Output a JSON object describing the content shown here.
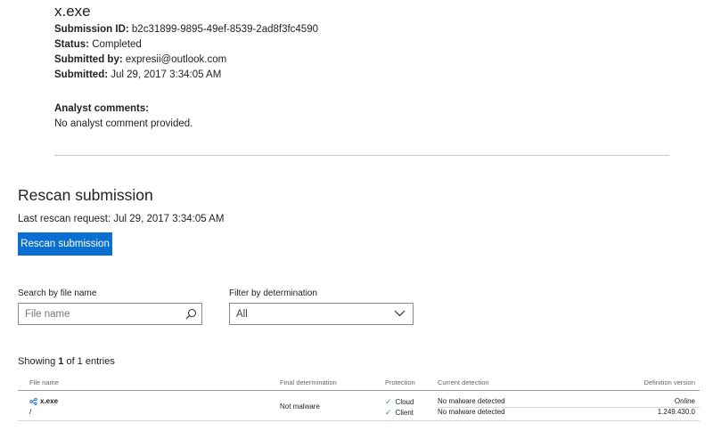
{
  "submission": {
    "file_name": "x.exe",
    "id_label": "Submission ID:",
    "id_value": "b2c31899-9895-49ef-8539-2ad8f3fc4590",
    "status_label": "Status:",
    "status_value": "Completed",
    "submitted_by_label": "Submitted by:",
    "submitted_by_value": "expresii@outlook.com",
    "submitted_label": "Submitted:",
    "submitted_value": "Jul 29, 2017 3:34:05 AM",
    "analyst_comments_label": "Analyst comments:",
    "analyst_comments_value": "No analyst comment provided."
  },
  "rescan": {
    "title": "Rescan submission",
    "last_request": "Last rescan request: Jul 29, 2017 3:34:05 AM",
    "button_label": "Rescan submission"
  },
  "filters": {
    "search_label": "Search by file name",
    "search_placeholder": "File name",
    "search_value": "",
    "determination_label": "Filter by determination",
    "determination_selected": "All"
  },
  "showing": {
    "prefix": "Showing ",
    "current": "1",
    "suffix": " of 1 entries"
  },
  "table": {
    "headers": {
      "file_name": "File name",
      "final_determination": "Final determination",
      "protection": "Protection",
      "current_detection": "Current detection",
      "definition_version": "Definition version"
    },
    "rows": [
      {
        "file_name": "x.exe",
        "path": "/",
        "final_determination": "Not malware",
        "protections": [
          {
            "name": "Cloud",
            "detection": "No malware detected",
            "version": "Online"
          },
          {
            "name": "Client",
            "detection": "No malware detected",
            "version": "1.249.430.0"
          }
        ]
      }
    ]
  },
  "colors": {
    "accent": "#0a6fd1",
    "check": "#3aa53a"
  },
  "icons": {
    "search": "search-icon",
    "dropdown": "chevron-down-icon",
    "file": "file-share-icon",
    "check": "check-icon"
  }
}
